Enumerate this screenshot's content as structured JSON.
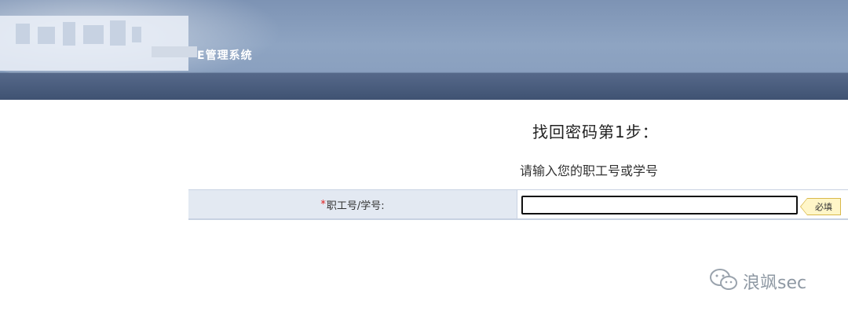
{
  "header": {
    "title": "E管理系统"
  },
  "page": {
    "step_title": "找回密码第1步：",
    "instruction": "请输入您的职工号或学号"
  },
  "form": {
    "required_mark": "*",
    "field_label": "职工号/学号:",
    "field_value": "",
    "required_tip": "必填"
  },
  "watermark": {
    "icon": "wechat-icon",
    "text": "浪飒sec"
  },
  "colors": {
    "header_top": "#8ea4c2",
    "header_band": "#465a78",
    "label_bg": "#e3e9f2",
    "required": "#e02020",
    "tip_bg": "#fff6c8"
  }
}
